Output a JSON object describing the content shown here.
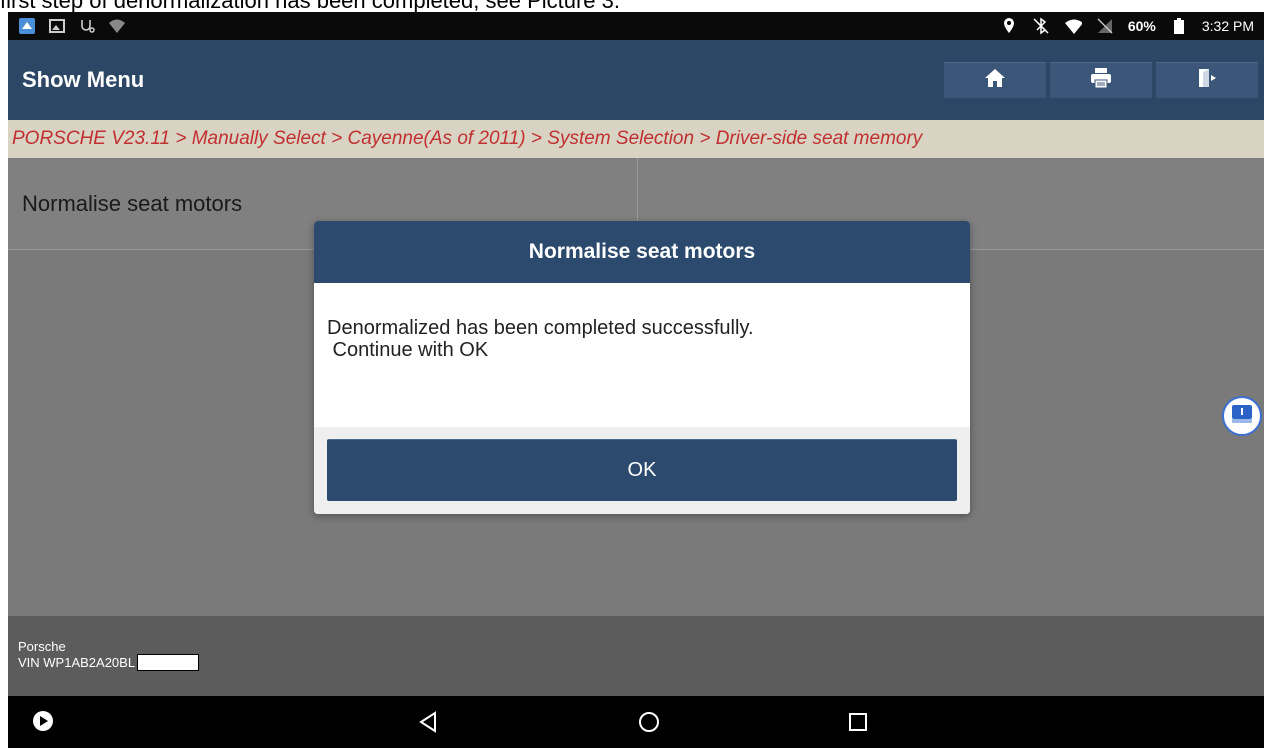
{
  "caption": "first step of denormalization has been completed, see Picture 3.",
  "status_bar": {
    "battery": "60%",
    "time": "3:32 PM",
    "icons_left": [
      "app-icon",
      "image-icon",
      "stethoscope-icon",
      "wifi-unknown-icon"
    ],
    "icons_right": [
      "location-icon",
      "bluetooth-off-icon",
      "wifi-icon",
      "no-sim-icon",
      "battery-icon"
    ]
  },
  "appbar": {
    "title": "Show Menu",
    "actions": [
      "home-icon",
      "print-icon",
      "exit-icon"
    ]
  },
  "breadcrumb": "PORSCHE V23.11 > Manually Select > Cayenne(As of 2011) > System Selection > Driver-side seat memory",
  "menu": {
    "items": [
      "Normalise seat motors"
    ]
  },
  "dialog": {
    "title": "Normalise seat motors",
    "message_line1": "Denormalized has been completed successfully.",
    "message_line2": " Continue with OK",
    "ok_label": "OK"
  },
  "footer": {
    "make": "Porsche",
    "vin": "VIN WP1AB2A20BL"
  },
  "colors": {
    "appbar": "#2c4666",
    "dialog_header": "#2c4a6e",
    "breadcrumb_text": "#c03030",
    "breadcrumb_bg": "#d9d3c4"
  }
}
